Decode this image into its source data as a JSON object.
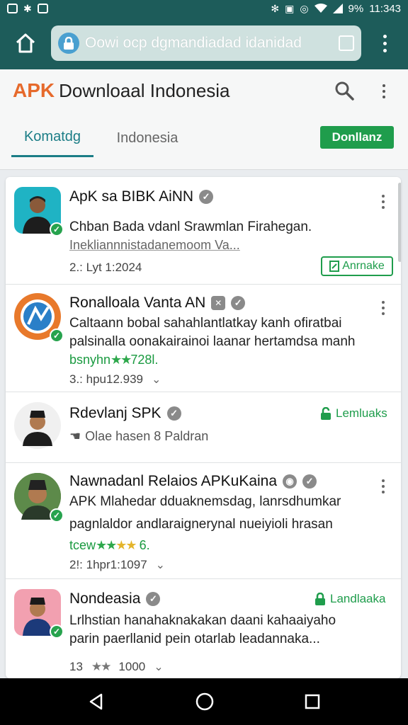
{
  "status_bar": {
    "battery": "9%",
    "time": "11:343"
  },
  "url_bar": {
    "url": "Oowi  ocp dgmandiadad idanidad"
  },
  "site": {
    "brand_apk": "APK",
    "brand_name": "Downloaal Indonesia",
    "tabs": [
      {
        "label": "Komatdg"
      },
      {
        "label": "Indonesia"
      }
    ],
    "download_button": "Donllanz"
  },
  "items": [
    {
      "title": "ApK sa BIBK AiNN",
      "desc": "Chban Bada vdanl Srawmlan Firahegan.",
      "link": "Inekliannnistadanemoom Va...",
      "meta": "2.: Lyt 1:2024",
      "action": "Anrnake"
    },
    {
      "title": "Ronalloala Vanta AN",
      "desc1": "Caltaann bobal sahahlantlatkay kanh ofiratbai",
      "desc2": "palsinalla oonakairainoi laanar hertamdsa manh",
      "rating_text": "bsnyhn",
      "rating_stars": "★★",
      "rating_value": "728l.",
      "meta": "3.: hpu12.939",
      "chevron": "⌄"
    },
    {
      "title": "Rdevlanj SPK",
      "line": "Olae hasen 8 Paldran",
      "action": "Lemluaks"
    },
    {
      "title": "Nawnadanl Relaios APKuKaina",
      "desc1": "APK Mlahedar dduaknemsdag, lanrsdhumkar",
      "desc2": "pagnlaldor andlaraignerynal nueiyioli hrasan",
      "rating_text": "tcew",
      "rating_stars": "★★",
      "rating_gold": "★★",
      "rating_value": "6.",
      "meta": "2!: 1hpr1:1097",
      "chevron": "⌄"
    },
    {
      "title": "Nondeasia",
      "desc1": "Lrlhstian hanahaknakakan daani kahaaiyaho",
      "desc2": "parin paerllanid pein otarlab leadannaka...",
      "rating_left": "13",
      "rating_stars": "★★",
      "rating_value": "1000",
      "chevron": "⌄",
      "action": "Landlaaka"
    }
  ],
  "colors": {
    "teal": "#1d5c5a",
    "brand_orange": "#e66a2c",
    "green": "#1f9d4c",
    "tab_accent": "#1b7d86"
  }
}
